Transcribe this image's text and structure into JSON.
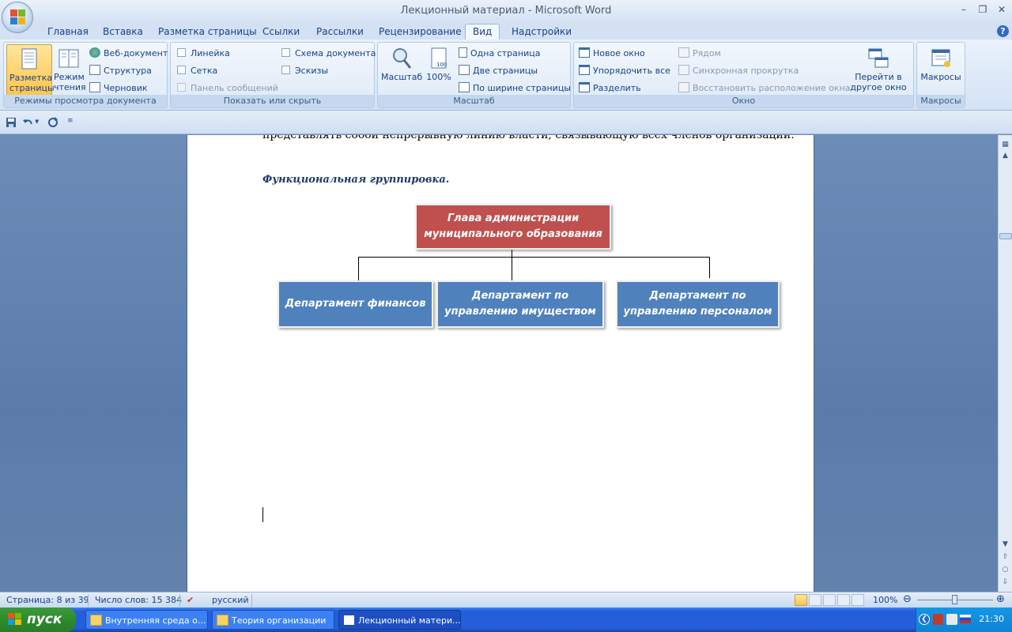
{
  "window": {
    "title": "Лекционный материал - Microsoft Word"
  },
  "tabs": [
    "Главная",
    "Вставка",
    "Разметка страницы",
    "Ссылки",
    "Рассылки",
    "Рецензирование",
    "Вид",
    "Надстройки"
  ],
  "active_tab": "Вид",
  "ribbon": {
    "views": {
      "label": "Режимы просмотра документа",
      "print_layout": "Разметка страницы",
      "reading": "Режим чтения",
      "web": "Веб-документ",
      "outline": "Структура",
      "draft": "Черновик"
    },
    "show_hide": {
      "label": "Показать или скрыть",
      "ruler": "Линейка",
      "gridlines": "Сетка",
      "message_bar": "Панель сообщений",
      "doc_map": "Схема документа",
      "thumbnails": "Эскизы"
    },
    "zoom": {
      "label": "Масштаб",
      "zoom_btn": "Масштаб",
      "hundred": "100%",
      "one_page": "Одна страница",
      "two_pages": "Две страницы",
      "page_width": "По ширине страницы"
    },
    "window": {
      "label": "Окно",
      "new_window": "Новое окно",
      "arrange_all": "Упорядочить все",
      "split": "Разделить",
      "side_by_side": "Рядом",
      "sync_scroll": "Синхронная прокрутка",
      "reset_position": "Восстановить расположение окна",
      "switch_windows": "Перейти в другое окно"
    },
    "macros": {
      "label": "Макросы",
      "macros_btn": "Макросы"
    }
  },
  "document": {
    "cut_text": "представлять собой непрерывную линию власти, связывающую всех членов организации.",
    "section_title": "Функциональная группировка.",
    "org_chart": {
      "root": "Глава администрации муниципального образования",
      "children": [
        "Департамент финансов",
        "Департамент по управлению имуществом",
        "Департамент по управлению персоналом"
      ]
    }
  },
  "statusbar": {
    "page": "Страница: 8 из 39",
    "words": "Число слов: 15 384",
    "language": "русский",
    "zoom": "100%"
  },
  "taskbar": {
    "start": "пуск",
    "tasks": [
      "Внутренняя среда о...",
      "Теория организации",
      "Лекционный матери..."
    ],
    "clock": "21:30"
  },
  "colors": {
    "root_box": "#c0504d",
    "child_box": "#4f81bd",
    "selected_button": "#ffc34d"
  }
}
